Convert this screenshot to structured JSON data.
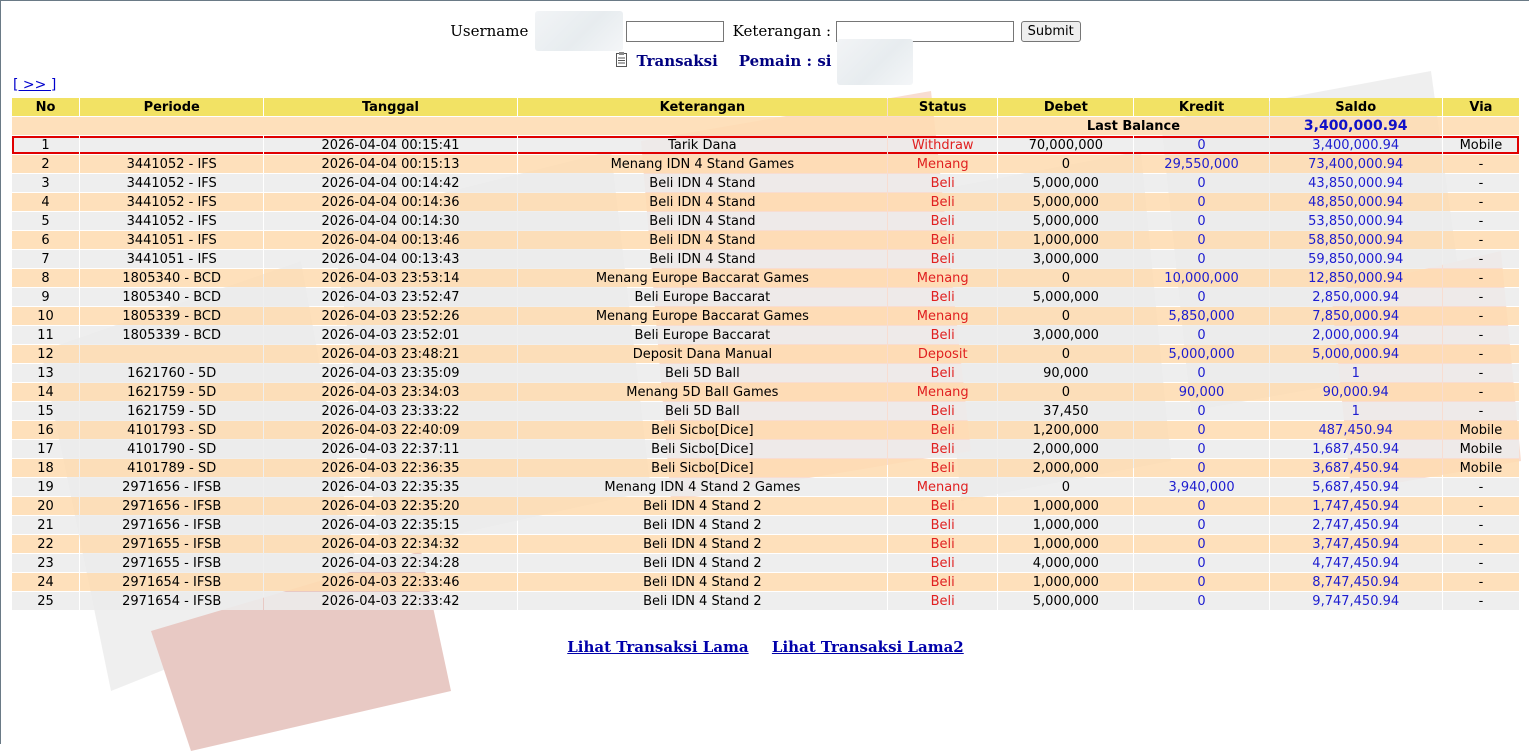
{
  "filter": {
    "username_label": "Username",
    "username_value": "",
    "keterangan_label": "Keterangan :",
    "keterangan_value": "",
    "submit_label": "Submit"
  },
  "heading": {
    "title": "Transaksi",
    "player_label": "Pemain : si"
  },
  "pager": {
    "next_label": "[ >> ]"
  },
  "table": {
    "columns": [
      "No",
      "Periode",
      "Tanggal",
      "Keterangan",
      "Status",
      "Debet",
      "Kredit",
      "Saldo",
      "Via"
    ],
    "last_balance_label": "Last Balance",
    "last_balance_value": "3,400,000.94",
    "rows": [
      {
        "no": "1",
        "periode": "",
        "tanggal": "2026-04-04 00:15:41",
        "keterangan": "Tarik Dana",
        "link": false,
        "status": "Withdraw",
        "debet": "70,000,000",
        "kredit": "0",
        "saldo": "3,400,000.94",
        "via": "Mobile",
        "highlight": true
      },
      {
        "no": "2",
        "periode": "3441052 - IFS",
        "tanggal": "2026-04-04 00:15:13",
        "keterangan": "Menang IDN 4 Stand Games",
        "link": true,
        "status": "Menang",
        "debet": "0",
        "kredit": "29,550,000",
        "saldo": "73,400,000.94",
        "via": "-"
      },
      {
        "no": "3",
        "periode": "3441052 - IFS",
        "tanggal": "2026-04-04 00:14:42",
        "keterangan": "Beli IDN 4 Stand",
        "link": true,
        "status": "Beli",
        "debet": "5,000,000",
        "kredit": "0",
        "saldo": "43,850,000.94",
        "via": "-"
      },
      {
        "no": "4",
        "periode": "3441052 - IFS",
        "tanggal": "2026-04-04 00:14:36",
        "keterangan": "Beli IDN 4 Stand",
        "link": true,
        "status": "Beli",
        "debet": "5,000,000",
        "kredit": "0",
        "saldo": "48,850,000.94",
        "via": "-"
      },
      {
        "no": "5",
        "periode": "3441052 - IFS",
        "tanggal": "2026-04-04 00:14:30",
        "keterangan": "Beli IDN 4 Stand",
        "link": true,
        "status": "Beli",
        "debet": "5,000,000",
        "kredit": "0",
        "saldo": "53,850,000.94",
        "via": "-"
      },
      {
        "no": "6",
        "periode": "3441051 - IFS",
        "tanggal": "2026-04-04 00:13:46",
        "keterangan": "Beli IDN 4 Stand",
        "link": true,
        "status": "Beli",
        "debet": "1,000,000",
        "kredit": "0",
        "saldo": "58,850,000.94",
        "via": "-"
      },
      {
        "no": "7",
        "periode": "3441051 - IFS",
        "tanggal": "2026-04-04 00:13:43",
        "keterangan": "Beli IDN 4 Stand",
        "link": true,
        "status": "Beli",
        "debet": "3,000,000",
        "kredit": "0",
        "saldo": "59,850,000.94",
        "via": "-"
      },
      {
        "no": "8",
        "periode": "1805340 - BCD",
        "tanggal": "2026-04-03 23:53:14",
        "keterangan": "Menang Europe Baccarat Games",
        "link": true,
        "status": "Menang",
        "debet": "0",
        "kredit": "10,000,000",
        "saldo": "12,850,000.94",
        "via": "-"
      },
      {
        "no": "9",
        "periode": "1805340 - BCD",
        "tanggal": "2026-04-03 23:52:47",
        "keterangan": "Beli Europe Baccarat",
        "link": true,
        "status": "Beli",
        "debet": "5,000,000",
        "kredit": "0",
        "saldo": "2,850,000.94",
        "via": "-"
      },
      {
        "no": "10",
        "periode": "1805339 - BCD",
        "tanggal": "2026-04-03 23:52:26",
        "keterangan": "Menang Europe Baccarat Games",
        "link": true,
        "status": "Menang",
        "debet": "0",
        "kredit": "5,850,000",
        "saldo": "7,850,000.94",
        "via": "-"
      },
      {
        "no": "11",
        "periode": "1805339 - BCD",
        "tanggal": "2026-04-03 23:52:01",
        "keterangan": "Beli Europe Baccarat",
        "link": true,
        "status": "Beli",
        "debet": "3,000,000",
        "kredit": "0",
        "saldo": "2,000,000.94",
        "via": "-"
      },
      {
        "no": "12",
        "periode": "",
        "tanggal": "2026-04-03 23:48:21",
        "keterangan": "Deposit Dana Manual",
        "link": false,
        "status": "Deposit",
        "debet": "0",
        "kredit": "5,000,000",
        "saldo": "5,000,000.94",
        "via": "-"
      },
      {
        "no": "13",
        "periode": "1621760 - 5D",
        "tanggal": "2026-04-03 23:35:09",
        "keterangan": "Beli 5D Ball",
        "link": true,
        "status": "Beli",
        "debet": "90,000",
        "kredit": "0",
        "saldo": "1",
        "via": "-"
      },
      {
        "no": "14",
        "periode": "1621759 - 5D",
        "tanggal": "2026-04-03 23:34:03",
        "keterangan": "Menang 5D Ball Games",
        "link": true,
        "status": "Menang",
        "debet": "0",
        "kredit": "90,000",
        "saldo": "90,000.94",
        "via": "-"
      },
      {
        "no": "15",
        "periode": "1621759 - 5D",
        "tanggal": "2026-04-03 23:33:22",
        "keterangan": "Beli 5D Ball",
        "link": true,
        "status": "Beli",
        "debet": "37,450",
        "kredit": "0",
        "saldo": "1",
        "via": "-"
      },
      {
        "no": "16",
        "periode": "4101793 - SD",
        "tanggal": "2026-04-03 22:40:09",
        "keterangan": "Beli Sicbo[Dice]",
        "link": true,
        "status": "Beli",
        "debet": "1,200,000",
        "kredit": "0",
        "saldo": "487,450.94",
        "via": "Mobile"
      },
      {
        "no": "17",
        "periode": "4101790 - SD",
        "tanggal": "2026-04-03 22:37:11",
        "keterangan": "Beli Sicbo[Dice]",
        "link": true,
        "status": "Beli",
        "debet": "2,000,000",
        "kredit": "0",
        "saldo": "1,687,450.94",
        "via": "Mobile"
      },
      {
        "no": "18",
        "periode": "4101789 - SD",
        "tanggal": "2026-04-03 22:36:35",
        "keterangan": "Beli Sicbo[Dice]",
        "link": true,
        "status": "Beli",
        "debet": "2,000,000",
        "kredit": "0",
        "saldo": "3,687,450.94",
        "via": "Mobile"
      },
      {
        "no": "19",
        "periode": "2971656 - IFSB",
        "tanggal": "2026-04-03 22:35:35",
        "keterangan": "Menang IDN 4 Stand 2 Games",
        "link": true,
        "status": "Menang",
        "debet": "0",
        "kredit": "3,940,000",
        "saldo": "5,687,450.94",
        "via": "-"
      },
      {
        "no": "20",
        "periode": "2971656 - IFSB",
        "tanggal": "2026-04-03 22:35:20",
        "keterangan": "Beli IDN 4 Stand 2",
        "link": true,
        "status": "Beli",
        "debet": "1,000,000",
        "kredit": "0",
        "saldo": "1,747,450.94",
        "via": "-"
      },
      {
        "no": "21",
        "periode": "2971656 - IFSB",
        "tanggal": "2026-04-03 22:35:15",
        "keterangan": "Beli IDN 4 Stand 2",
        "link": true,
        "status": "Beli",
        "debet": "1,000,000",
        "kredit": "0",
        "saldo": "2,747,450.94",
        "via": "-"
      },
      {
        "no": "22",
        "periode": "2971655 - IFSB",
        "tanggal": "2026-04-03 22:34:32",
        "keterangan": "Beli IDN 4 Stand 2",
        "link": true,
        "status": "Beli",
        "debet": "1,000,000",
        "kredit": "0",
        "saldo": "3,747,450.94",
        "via": "-"
      },
      {
        "no": "23",
        "periode": "2971655 - IFSB",
        "tanggal": "2026-04-03 22:34:28",
        "keterangan": "Beli IDN 4 Stand 2",
        "link": true,
        "status": "Beli",
        "debet": "4,000,000",
        "kredit": "0",
        "saldo": "4,747,450.94",
        "via": "-"
      },
      {
        "no": "24",
        "periode": "2971654 - IFSB",
        "tanggal": "2026-04-03 22:33:46",
        "keterangan": "Beli IDN 4 Stand 2",
        "link": true,
        "status": "Beli",
        "debet": "1,000,000",
        "kredit": "0",
        "saldo": "8,747,450.94",
        "via": "-"
      },
      {
        "no": "25",
        "periode": "2971654 - IFSB",
        "tanggal": "2026-04-03 22:33:42",
        "keterangan": "Beli IDN 4 Stand 2",
        "link": true,
        "status": "Beli",
        "debet": "5,000,000",
        "kredit": "0",
        "saldo": "9,747,450.94",
        "via": "-"
      }
    ]
  },
  "footer": {
    "old_transactions_label": "Lihat Transaksi Lama",
    "old_transactions2_label": "Lihat Transaksi Lama2"
  },
  "colors": {
    "header_bg": "#f2e264",
    "row_even_bg": "#fedcb2",
    "row_odd_bg": "#ececec",
    "status_red": "#e02020",
    "value_blue": "#1d1dd0",
    "highlight_border": "#e00000"
  }
}
